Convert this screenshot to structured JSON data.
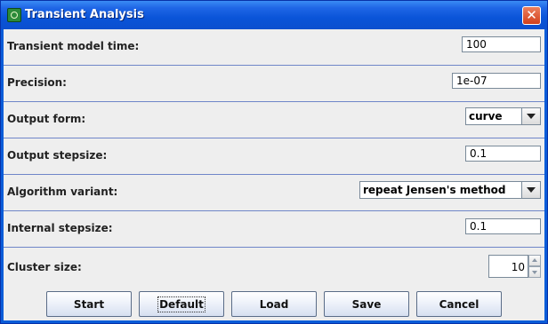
{
  "window": {
    "title": "Transient Analysis",
    "close_symbol": "✕"
  },
  "fields": {
    "model_time": {
      "label": "Transient model time:",
      "value": "100"
    },
    "precision": {
      "label": "Precision:",
      "value": "1e-07"
    },
    "output_form": {
      "label": "Output form:",
      "value": "curve"
    },
    "output_stepsize": {
      "label": "Output stepsize:",
      "value": "0.1"
    },
    "algorithm_variant": {
      "label": "Algorithm variant:",
      "value": "repeat Jensen's method"
    },
    "internal_stepsize": {
      "label": "Internal stepsize:",
      "value": "0.1"
    },
    "cluster_size": {
      "label": "Cluster size:",
      "value": "10"
    }
  },
  "buttons": {
    "start": "Start",
    "default": "Default",
    "load": "Load",
    "save": "Save",
    "cancel": "Cancel"
  },
  "colors": {
    "titlebar": "#0a54d8",
    "panel": "#eeeeee",
    "separator": "#6f86c8",
    "close": "#d2401c"
  }
}
